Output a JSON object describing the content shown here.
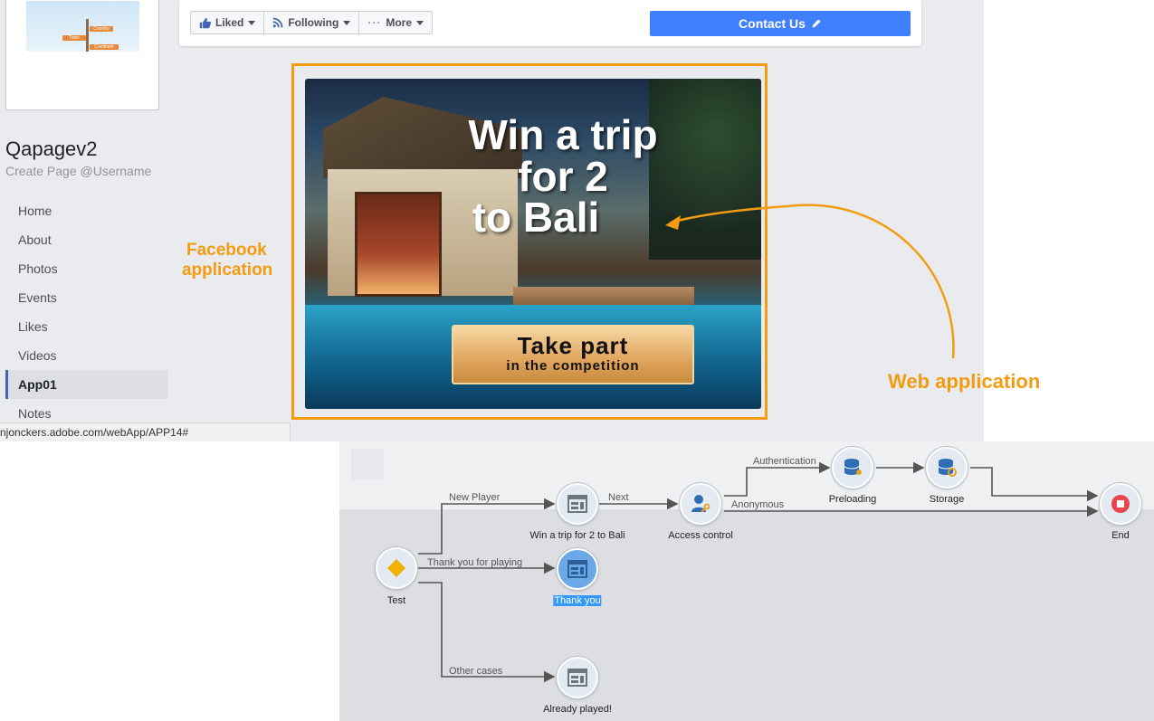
{
  "profile": {
    "sign_labels": [
      "Country",
      "Town",
      "Continent"
    ]
  },
  "page": {
    "name": "Qapagev2",
    "username": "Create Page @Username"
  },
  "nav": {
    "items": [
      "Home",
      "About",
      "Photos",
      "Events",
      "Likes",
      "Videos",
      "App01",
      "Notes"
    ],
    "active": "App01"
  },
  "actions": {
    "liked": "Liked",
    "following": "Following",
    "more": "More",
    "contact": "Contact Us"
  },
  "promo": {
    "line1": "Win a trip",
    "line2": "for 2",
    "line3": "to Bali",
    "cta_main": "Take part",
    "cta_sub": "in the competition"
  },
  "annotations": {
    "facebook_line1": "Facebook",
    "facebook_line2": "application",
    "web": "Web application",
    "color": "#f39c12"
  },
  "status": {
    "url": "njonckers.adobe.com/webApp/APP14#"
  },
  "workflow": {
    "nodes": {
      "test": "Test",
      "win": "Win a trip for 2 to Bali",
      "access": "Access control",
      "preloading": "Preloading",
      "storage": "Storage",
      "end": "End",
      "thankyou": "Thank you",
      "already": "Already played!"
    },
    "edges": {
      "new_player": "New Player",
      "next": "Next",
      "authentication": "Authentication",
      "anonymous": "Anonymous",
      "thank_you_playing": "Thank you for playing",
      "other_cases": "Other cases"
    }
  }
}
